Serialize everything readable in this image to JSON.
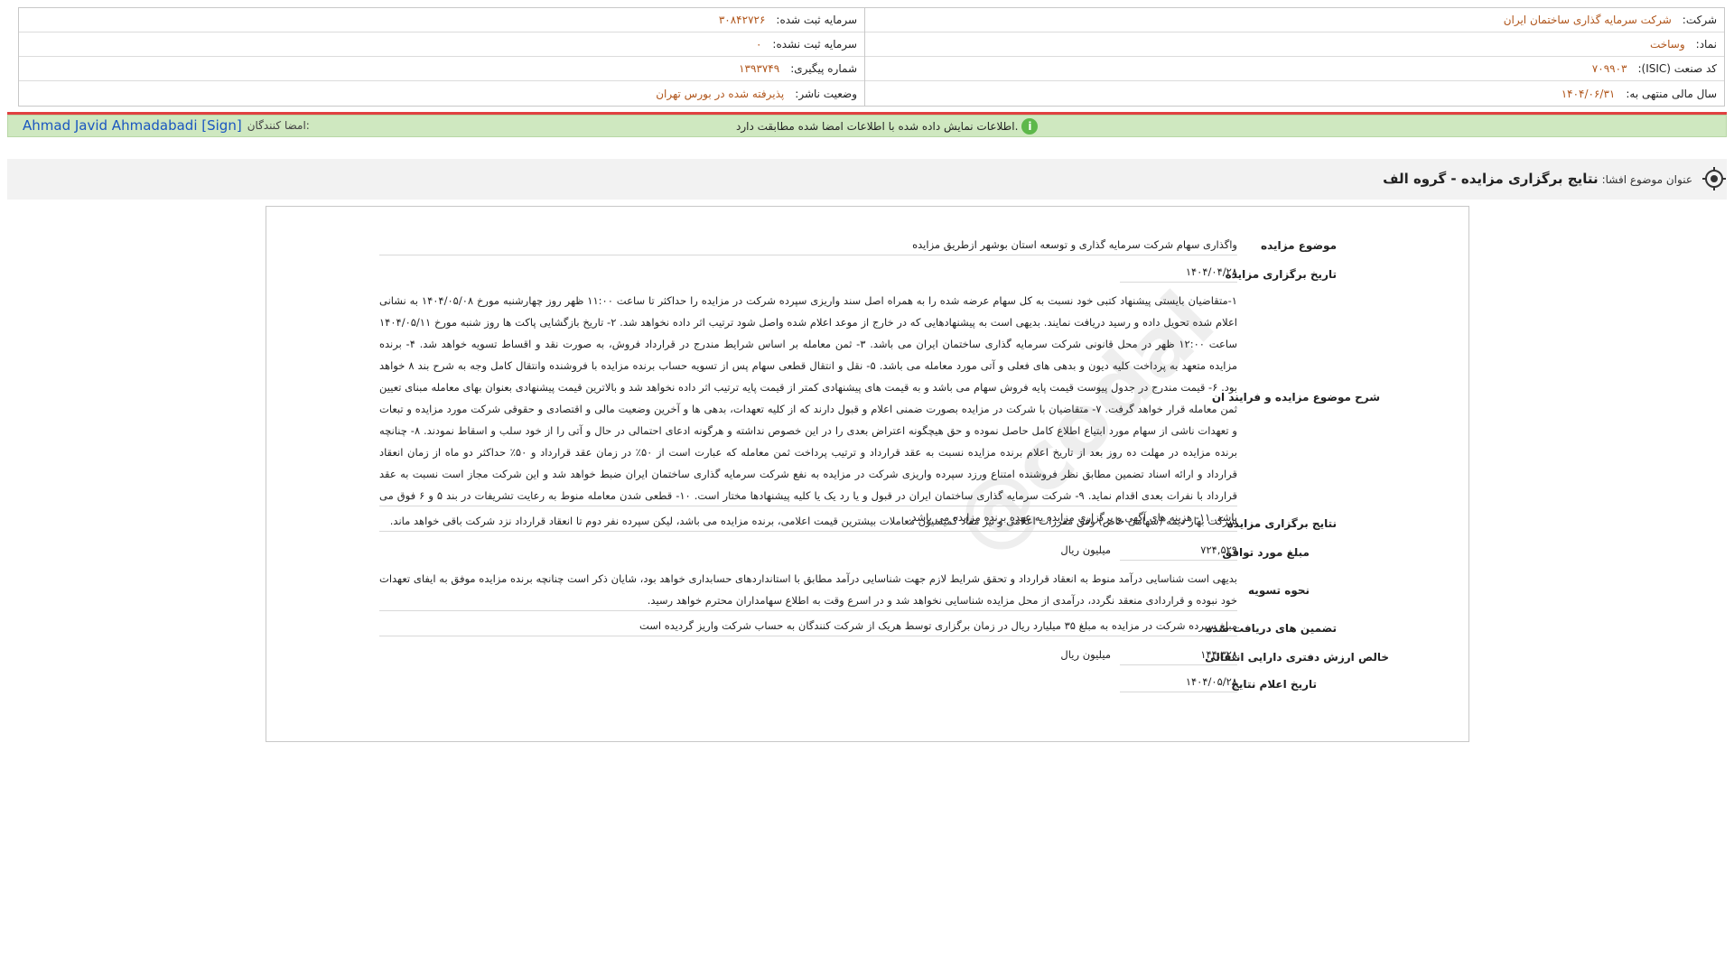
{
  "header": {
    "right": [
      {
        "label": "شرکت:",
        "value": "شرکت سرمایه گذاری ساختمان ایران"
      },
      {
        "label": "نماد:",
        "value": "وساخت"
      },
      {
        "label": "کد صنعت (ISIC):",
        "value": "۷۰۹۹۰۳"
      },
      {
        "label": "سال مالی منتهی به:",
        "value": "۱۴۰۴/۰۶/۳۱"
      }
    ],
    "left": [
      {
        "label": "سرمایه ثبت شده:",
        "value": "۳۰۸۴۲۷۲۶"
      },
      {
        "label": "سرمایه ثبت نشده:",
        "value": "۰"
      },
      {
        "label": "شماره پیگیری:",
        "value": "۱۳۹۳۷۴۹"
      },
      {
        "label": "وضعیت ناشر:",
        "value": "پذیرفته شده در بورس تهران"
      }
    ]
  },
  "signbar": {
    "signers_label": "امضا کنندگان:",
    "signer_name": "Ahmad Javid Ahmadabadi [Sign]",
    "verify_text": "اطلاعات نمایش داده شده با اطلاعات امضا شده مطابقت دارد.",
    "colors": {
      "bar": "#cfe8c0",
      "alert_line": "#e04040",
      "link": "#1a56c0"
    }
  },
  "subject": {
    "label": "عنوان موضوع افشا:",
    "value": "نتایج برگزاری مزایده - گروه الف"
  },
  "watermark": "@codal",
  "fields": {
    "auction_subject": {
      "label": "موضوع مزایده",
      "value": "واگذاری سهام شرکت سرمایه گذاری و توسعه استان بوشهر ازطریق مزایده"
    },
    "auction_date": {
      "label": "تاریخ برگزاری مزایده",
      "value": "۱۴۰۴/۰۴/۲۸"
    },
    "description": {
      "label": "شرح موضوع مزایده و فرایند ان",
      "value": "۱-متقاضیان بایستی پیشنهاد کتبی خود نسبت به کل سهام عرضه شده را به همراه اصل سند واریزی سپرده شرکت در مزایده را حداکثر تا ساعت ۱۱:۰۰ ظهر روز چهارشنبه مورخ ۱۴۰۴/۰۵/۰۸ به نشانی اعلام شده تحویل داده و رسید دریافت نمایند. بدیهی است به پیشنهادهایی که در خارج از موعد اعلام شده واصل شود ترتیب اثر داده نخواهد شد. ۲- تاریخ بازگشایی پاکت ها روز شنبه مورخ ۱۴۰۴/۰۵/۱۱ ساعت ۱۲:۰۰ ظهر در محل قانونی شرکت سرمایه گذاری ساختمان ایران می باشد. ۳- ثمن معامله بر اساس شرایط مندرج در قرارداد فروش، به صورت نقد و اقساط تسویه خواهد شد. ۴- برنده مزایده متعهد به پرداخت کلیه دیون و بدهی های فعلی و آتی مورد معامله می باشد. ۵- نقل و انتقال قطعی سهام پس از تسویه حساب برنده مزایده با فروشنده وانتقال کامل وجه به شرح بند ۸ خواهد بود. ۶- قیمت مندرج در جدول پیوست قیمت پایه فروش سهام می باشد و به قیمت های پیشنهادی کمتر از قیمت پایه ترتیب اثر داده نخواهد شد و بالاترین قیمت پیشنهادی بعنوان بهای معامله مبنای تعیین ثمن معامله قرار خواهد گرفت. ۷- متقاضیان با شرکت در مزایده بصورت ضمنی اعلام و قبول دارند که از کلیه تعهدات، بدهی ها و آخرین وضعیت مالی و اقتصادی و حقوقی شرکت مورد مزایده و تبعات و تعهدات ناشی از سهام مورد ابتیاع اطلاع کامل حاصل نموده و حق هیچگونه اعتراض بعدی را در این خصوص نداشته و هرگونه ادعای احتمالی در حال و آتی را از خود سلب و اسقاط نمودند. ۸- چنانچه برنده مزایده در مهلت ده روز بعد از تاریخ اعلام برنده مزایده نسبت به عقد قرارداد و ترتیب پرداخت ثمن معامله که عبارت است از ۵۰٪ در زمان عقد قرارداد و ۵۰٪ حداکثر دو ماه از زمان انعقاد قرارداد و ارائه اسناد تضمین مطابق نظر فروشنده امتناع ورزد سپرده واریزی شرکت در مزایده به نفع شرکت سرمایه گذاری ساختمان ایران ضبط خواهد شد و این شرکت مجاز است نسبت به عقد قرارداد با نفرات بعدی اقدام نماید. ۹- شرکت سرمایه گذاری ساختمان ایران در قبول و یا رد یک یا کلیه پیشنهادها مختار است. ۱۰- قطعی شدن معامله منوط به رعایت تشریفات در بند ۵ و ۶ فوق می باشد. ۱۱- هزینه های آگهی و برگزاری مزایده به عهده برنده مزایده می باشد."
    },
    "auction_results": {
      "label": "نتایج برگزاری مزایده",
      "value": "شرکت بهار دیمه (سهامی خاص) وفق مقررات اعلامی و نیز مفاد کمیسیون معاملات بیشترین قیمت اعلامی، برنده مزایده می باشد، لیکن سپرده نفر دوم تا انعقاد قرارداد نزد شرکت باقی خواهد ماند."
    },
    "agreed_amount": {
      "label": "مبلغ مورد توافق",
      "value": "۷۲۴,۵۲۹",
      "unit": "میلیون ریال"
    },
    "settlement": {
      "label": "نحوه تسویه",
      "value": "بدیهی است شناسایی درآمد منوط به انعقاد قرارداد و تحقق شرایط لازم جهت شناسایی درآمد مطابق با استانداردهای حسابداری خواهد بود، شایان ذکر است چنانچه برنده مزایده موفق به ایفای تعهدات خود نبوده و قراردادی منعقد نگردد، درآمدی از محل مزایده شناسایی نخواهد شد و در اسرع وقت به اطلاع سهامداران محترم خواهد رسید."
    },
    "guarantees": {
      "label": "تضمین های دریافت شده",
      "value": "مبلغ سپرده شرکت در مزایده به مبلغ ۳۵ میلیارد ریال در زمان برگزاری توسط هریک از شرکت کنندگان به حساب شرکت واریز گردیده است"
    },
    "net_book_value": {
      "label": "خالص ارزش دفتری دارایی انتقالی",
      "value": "۱۴۴,۳۲۸",
      "unit": "میلیون ریال"
    },
    "announce_date": {
      "label": "تاریخ اعلام نتایج",
      "value": "۱۴۰۴/۰۵/۲۸"
    }
  }
}
